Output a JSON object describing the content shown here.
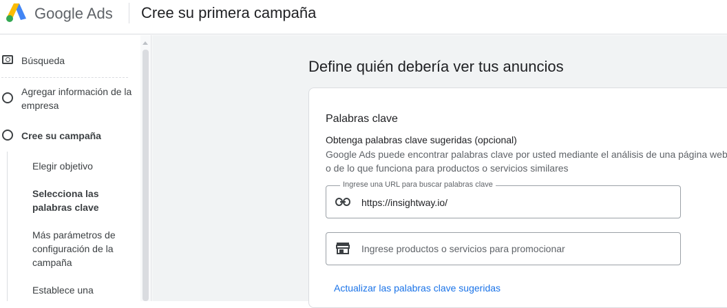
{
  "header": {
    "brand": "Google Ads",
    "title": "Cree su primera campaña"
  },
  "sidebar": {
    "items": [
      {
        "label": "Búsqueda",
        "icon": "search-box-icon"
      },
      {
        "label": "Agregar información de la empresa",
        "icon": "circle-icon"
      },
      {
        "label": "Cree su campaña",
        "icon": "circle-icon"
      }
    ],
    "subitems": [
      {
        "label": "Elegir objetivo"
      },
      {
        "label": "Selecciona las palabras clave"
      },
      {
        "label": "Más parámetros de configuración de la campaña"
      },
      {
        "label": "Establece una"
      }
    ]
  },
  "main": {
    "heading": "Define quién debería ver tus anuncios",
    "card": {
      "title": "Palabras clave",
      "subtitle": "Obtenga palabras clave sugeridas (opcional)",
      "desc_line1": "Google Ads puede encontrar palabras clave por usted mediante el análisis de una página web",
      "desc_line2": "o de lo que funciona para productos o servicios similares",
      "url_field": {
        "label": "Ingrese una URL para buscar palabras clave",
        "value": "https://insightway.io/",
        "icon": "link-icon"
      },
      "products_field": {
        "placeholder": "Ingrese productos o servicios para promocionar",
        "icon": "storefront-icon"
      },
      "update_link": "Actualizar las palabras clave sugeridas"
    }
  },
  "colors": {
    "link": "#1a73e8",
    "background": "#f1f3f4",
    "border": "#dadce0"
  }
}
